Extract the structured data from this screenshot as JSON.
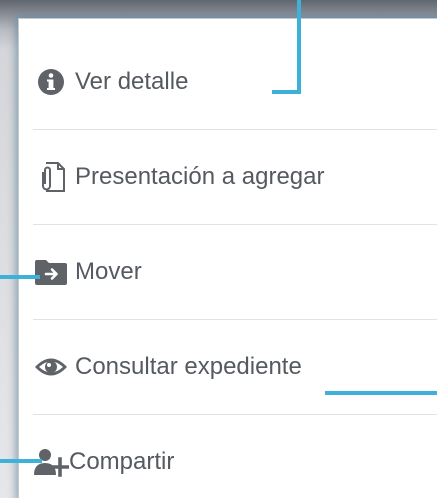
{
  "menu": {
    "items": [
      {
        "id": "ver-detalle",
        "label": "Ver detalle",
        "icon": "info-circle-icon"
      },
      {
        "id": "presentacion",
        "label": "Presentación a agregar",
        "icon": "paperclip-document-icon"
      },
      {
        "id": "mover",
        "label": "Mover",
        "icon": "folder-arrow-icon"
      },
      {
        "id": "consultar",
        "label": "Consultar expediente",
        "icon": "eye-icon"
      },
      {
        "id": "compartir",
        "label": "Compartir",
        "icon": "user-add-icon"
      }
    ]
  },
  "colors": {
    "text": "#555a60",
    "icon": "#5f6368",
    "callout": "#3eb1d8",
    "divider": "#e2e2e2"
  }
}
